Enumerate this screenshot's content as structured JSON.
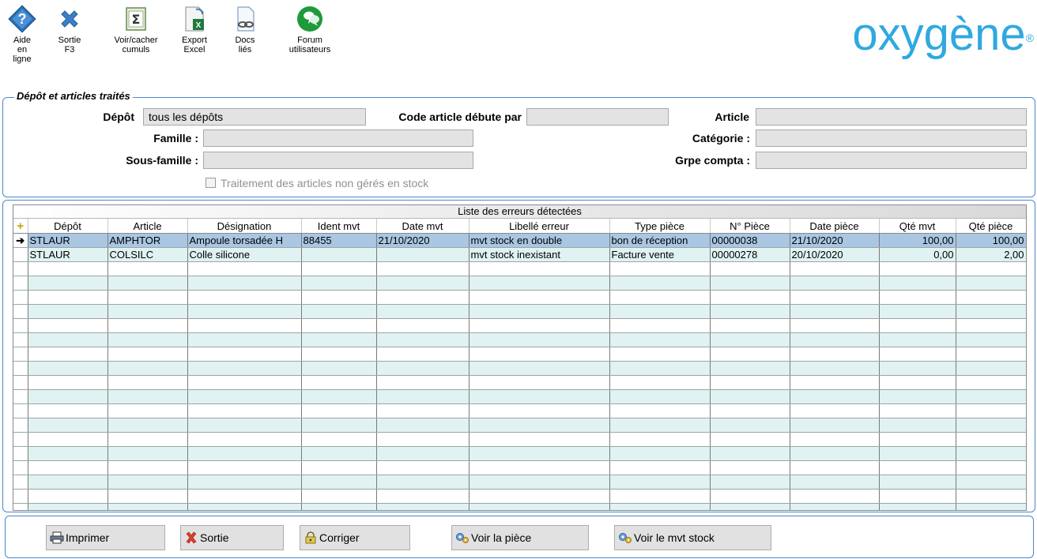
{
  "toolbar": {
    "help": "Aide\nen\nligne",
    "exit": "Sortie\nF3",
    "cumuls": "Voir/cacher\ncumuls",
    "export": "Export\nExcel",
    "docs": "Docs\nliés",
    "forum": "Forum\nutilisateurs"
  },
  "logo": "oxygène",
  "filters": {
    "group_title": "Dépôt et articles traités",
    "depot_label": "Dépôt",
    "depot_value": "tous les dépôts",
    "code_label": "Code article débute par",
    "code_value": "",
    "article_label": "Article",
    "article_value": "",
    "famille_label": "Famille :",
    "famille_value": "",
    "categorie_label": "Catégorie :",
    "categorie_value": "",
    "sousfamille_label": "Sous-famille :",
    "sousfamille_value": "",
    "grpe_label": "Grpe compta :",
    "grpe_value": "",
    "checkbox_label": "Traitement des articles non gérés en stock",
    "checkbox_checked": false
  },
  "grid": {
    "title": "Liste des erreurs détectées",
    "columns": [
      "Dépôt",
      "Article",
      "Désignation",
      "Ident mvt",
      "Date mvt",
      "Libellé erreur",
      "Type pièce",
      "N° Pièce",
      "Date pièce",
      "Qté mvt",
      "Qté pièce"
    ],
    "rows": [
      [
        "STLAUR",
        "AMPHTOR",
        "Ampoule torsadée H",
        "88455",
        "21/10/2020",
        "mvt stock en double",
        "bon de réception",
        "00000038",
        "21/10/2020",
        "100,00",
        "100,00"
      ],
      [
        "STLAUR",
        "COLSILC",
        "Colle silicone",
        "",
        "",
        "mvt stock inexistant",
        "Facture vente",
        "00000278",
        "20/10/2020",
        "0,00",
        "2,00"
      ]
    ],
    "selected_row": 0
  },
  "buttons": {
    "print": "Imprimer",
    "exit": "Sortie",
    "fix": "Corriger",
    "view_piece": "Voir la pièce",
    "view_mvt": "Voir le mvt stock"
  },
  "colors": {
    "accent": "#2fa9de",
    "border": "#4a88c8",
    "row_alt": "#e0f2f2",
    "row_selected": "#a9c6e3"
  }
}
